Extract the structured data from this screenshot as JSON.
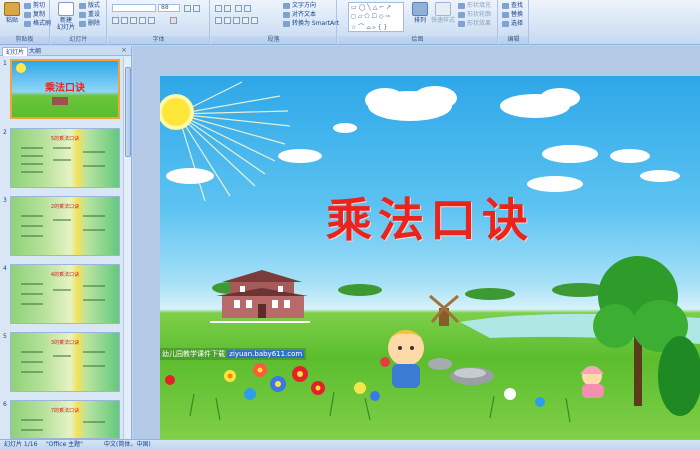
{
  "ribbon": {
    "clipboard": {
      "paste": "粘贴",
      "cut": "剪切",
      "copy": "复制",
      "format_painter": "格式刷",
      "label": "剪贴板"
    },
    "slides": {
      "new_slide": "新建\n幻灯片",
      "layout": "版式",
      "reset": "重设",
      "delete": "删除",
      "label": "幻灯片"
    },
    "font": {
      "font_name": "",
      "font_size": "88",
      "label": "字体"
    },
    "paragraph": {
      "text_direction": "文字方向",
      "align_text": "对齐文本",
      "smartart": "转换为 SmartArt",
      "label": "段落"
    },
    "drawing": {
      "arrange": "排列",
      "quick_styles": "快速样式",
      "shape_fill": "形状填充",
      "shape_outline": "形状轮廓",
      "shape_effects": "形状效果",
      "label": "绘图"
    },
    "editing": {
      "find": "查找",
      "replace": "替换",
      "select": "选择",
      "label": "编辑"
    }
  },
  "left_pane": {
    "tab_slides": "幻灯片",
    "tab_outline": "大纲",
    "close": "×",
    "thumbs": [
      {
        "num": "1",
        "title": "乘法口诀"
      },
      {
        "num": "2",
        "title": "5的乘法口诀"
      },
      {
        "num": "3",
        "title": "2的乘法口诀"
      },
      {
        "num": "4",
        "title": "4的乘法口诀"
      },
      {
        "num": "5",
        "title": "3的乘法口诀"
      },
      {
        "num": "6",
        "title": "7的乘法口诀"
      }
    ]
  },
  "slide": {
    "title": "乘法口诀",
    "watermark_prefix": "幼儿园教学课件下载",
    "watermark_url": "ziyuan.baby611.com"
  },
  "status_bar": {
    "slide_count": "幻灯片 1/16",
    "theme": "\"Office 主题\"",
    "language": "中文(简体，中国)"
  },
  "colors": {
    "title_red": "#e8241c",
    "sky": "#5cc3f2",
    "grass": "#5bbd2e",
    "selected_thumb": "#f3a33a"
  }
}
